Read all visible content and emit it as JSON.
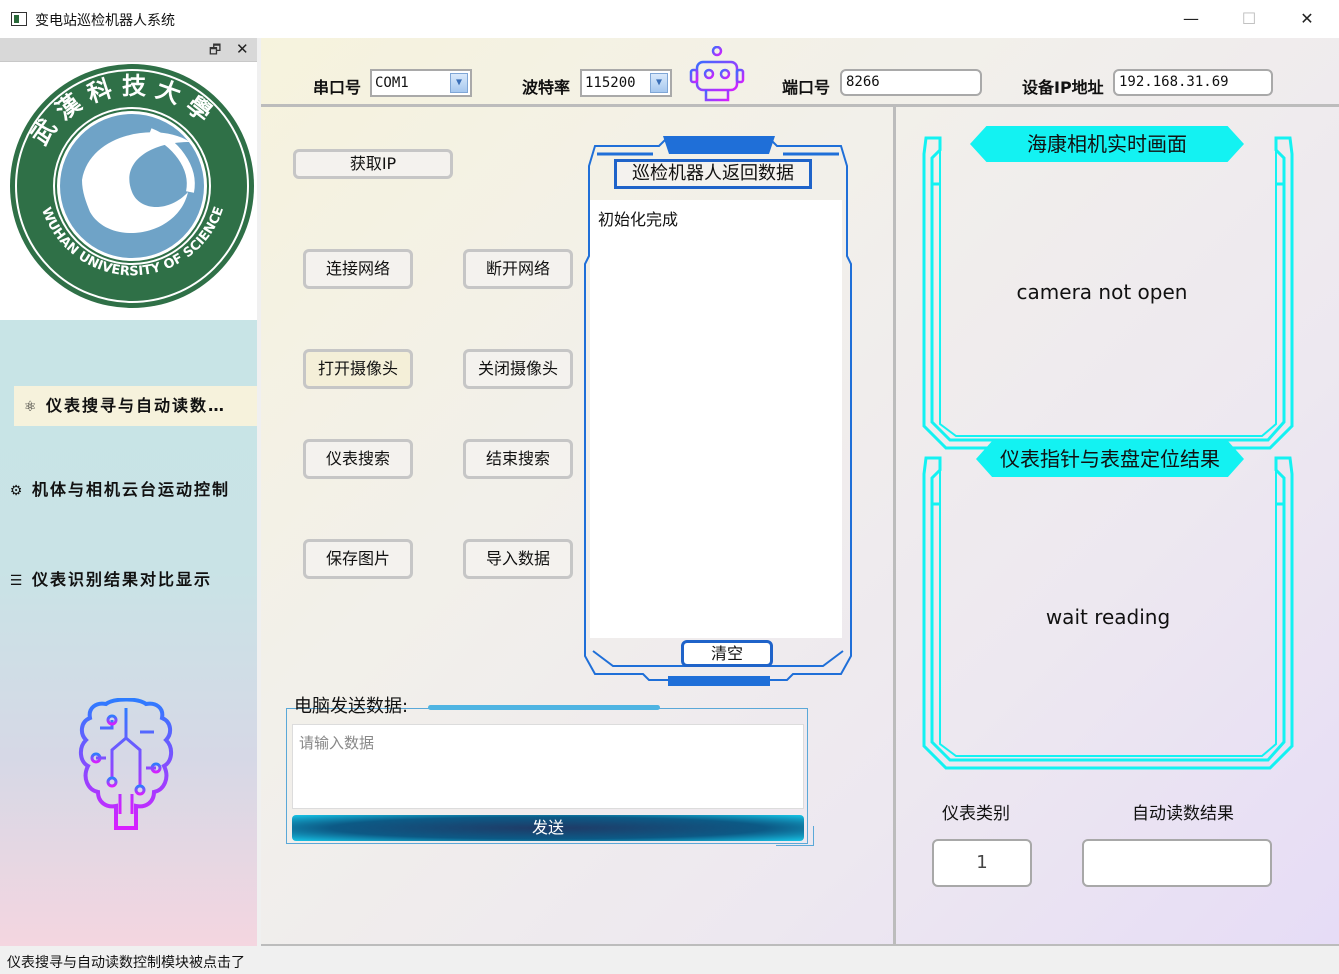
{
  "window": {
    "title": "变电站巡检机器人系统",
    "controls": {
      "minimize": "—",
      "maximize": "☐",
      "close": "✕"
    }
  },
  "dock": {
    "float_icon": "restore-icon",
    "close_icon": "close-icon"
  },
  "sidebar": {
    "items": [
      {
        "label": "仪表搜寻与自动读数…",
        "icon": "brain-icon",
        "active": true
      },
      {
        "label": "机体与相机云台运动控制",
        "icon": "cubes-icon",
        "active": false
      },
      {
        "label": "仪表识别结果对比显示",
        "icon": "list-icon",
        "active": false
      }
    ]
  },
  "topbar": {
    "serial_label": "串口号",
    "serial_value": "COM1",
    "baud_label": "波特率",
    "baud_value": "115200",
    "port_label": "端口号",
    "port_value": "8266",
    "ip_label": "设备IP地址",
    "ip_value": "192.168.31.69"
  },
  "controls": {
    "get_ip": "获取IP",
    "connect": "连接网络",
    "disconnect": "断开网络",
    "open_camera": "打开摄像头",
    "close_camera": "关闭摄像头",
    "search": "仪表搜索",
    "end_search": "结束搜索",
    "save_image": "保存图片",
    "import_data": "导入数据"
  },
  "robot_panel": {
    "title": "巡检机器人返回数据",
    "content": "初始化完成",
    "clear": "清空"
  },
  "send": {
    "label": "电脑发送数据:",
    "placeholder": "请输入数据",
    "button": "发送"
  },
  "camera_panel": {
    "title": "海康相机实时画面",
    "status": "camera not open"
  },
  "result_panel": {
    "title": "仪表指针与表盘定位结果",
    "status": "wait reading"
  },
  "outputs": {
    "type_label": "仪表类别",
    "type_value": "1",
    "reading_label": "自动读数结果",
    "reading_value": ""
  },
  "status_bar": {
    "message": "仪表搜寻与自动读数控制模块被点击了"
  },
  "colors": {
    "cyan": "#13f2f2",
    "blue_frame": "#1f63c9",
    "gradient_icon": "#a020ff"
  }
}
